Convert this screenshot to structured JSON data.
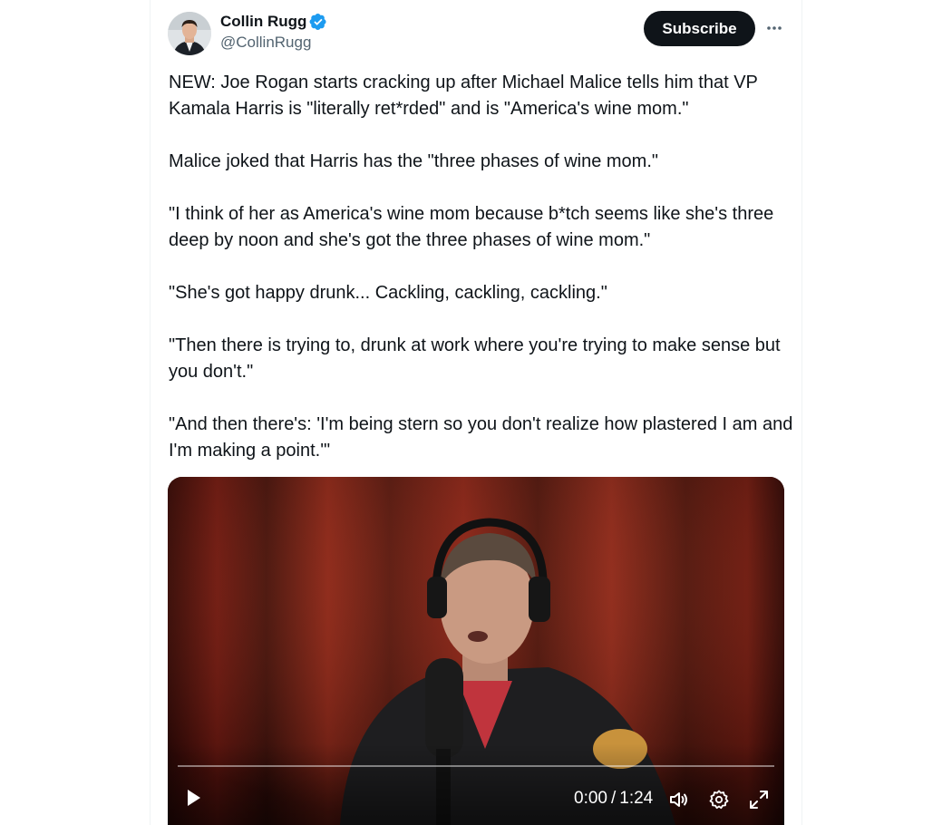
{
  "author": {
    "display_name": "Collin Rugg",
    "handle": "@CollinRugg",
    "verified": true
  },
  "actions": {
    "subscribe_label": "Subscribe",
    "more_icon": "more-horizontal-icon"
  },
  "tweet": {
    "paragraphs": [
      "NEW: Joe Rogan starts cracking up after Michael Malice tells him that VP Kamala Harris is \"literally ret*rded\" and is \"America's wine mom.\"",
      "Malice joked that Harris has the \"three phases of wine mom.\"",
      "\"I think of her as America's wine mom because b*tch seems like she's three deep by noon and she's got the three phases of wine mom.\"",
      "\"She's got happy drunk... Cackling, cackling, cackling.\"",
      "\"Then there is trying to, drunk at work where you're trying to make sense but you don't.\"",
      "\"And then there's: 'I'm being stern so you don't realize how plastered I am and I'm making a point.'\""
    ]
  },
  "video": {
    "current_time": "0:00",
    "duration": "1:24",
    "progress": 0,
    "controls": [
      "play-icon",
      "volume-icon",
      "settings-icon",
      "fullscreen-icon"
    ]
  },
  "colors": {
    "verified_blue": "#1d9bf0",
    "text_primary": "#0f1419",
    "text_secondary": "#536471",
    "button_dark": "#0f1419"
  }
}
